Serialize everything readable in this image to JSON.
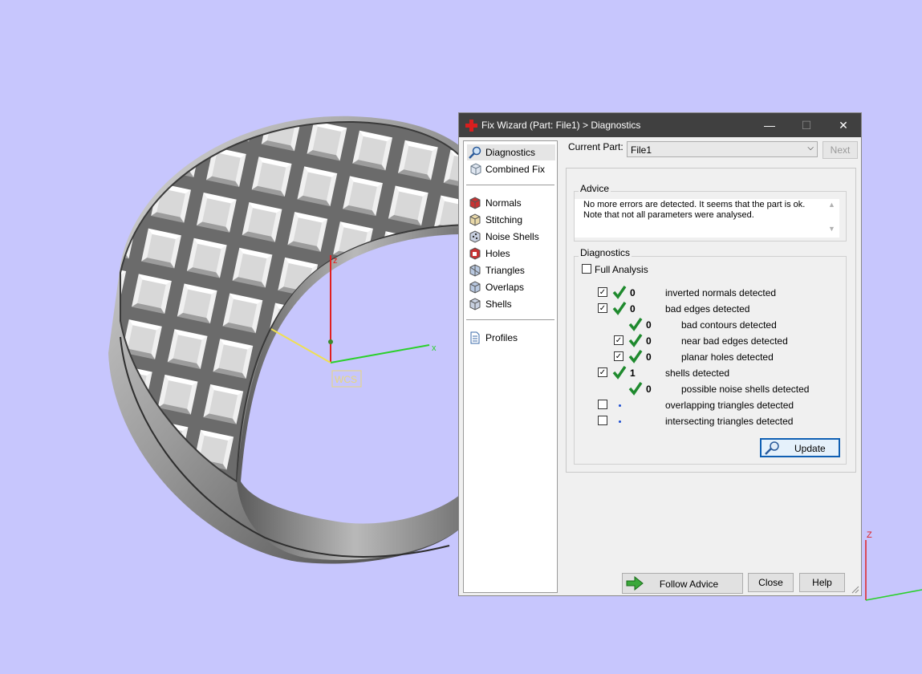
{
  "viewport": {
    "wcs_label": "WCS",
    "axes": {
      "z": "z",
      "x": "x"
    },
    "corner_axis_z": "Z"
  },
  "dialog": {
    "title": "Fix Wizard (Part: File1) > Diagnostics",
    "title_buttons": {
      "minimize": "—",
      "maximize": "☐",
      "close": "✕"
    },
    "nav": {
      "items": [
        {
          "label": "Diagnostics",
          "icon": "magnifier-icon",
          "selected": true
        },
        {
          "label": "Combined Fix",
          "icon": "cube-icon"
        },
        {
          "label": "Normals",
          "icon": "normals-cube-icon"
        },
        {
          "label": "Stitching",
          "icon": "stitching-cube-icon"
        },
        {
          "label": "Noise Shells",
          "icon": "noise-shells-icon"
        },
        {
          "label": "Holes",
          "icon": "holes-cube-icon"
        },
        {
          "label": "Triangles",
          "icon": "triangles-cube-icon"
        },
        {
          "label": "Overlaps",
          "icon": "overlaps-cube-icon"
        },
        {
          "label": "Shells",
          "icon": "shells-cube-icon"
        },
        {
          "label": "Profiles",
          "icon": "document-icon"
        }
      ]
    },
    "current_part": {
      "label": "Current Part:",
      "value": "File1"
    },
    "next_label": "Next",
    "advice": {
      "title": "Advice",
      "line1": "No more errors are detected. It seems that the part is ok.",
      "line2": "Note that not all parameters were analysed."
    },
    "diagnostics": {
      "title": "Diagnostics",
      "full_analysis": {
        "label": "Full Analysis",
        "checked": false
      },
      "rows": [
        {
          "checkbox": true,
          "checked": true,
          "status": "check",
          "count": "0",
          "label": "inverted normals detected",
          "indent": 0
        },
        {
          "checkbox": true,
          "checked": true,
          "status": "check",
          "count": "0",
          "label": "bad edges detected",
          "indent": 0
        },
        {
          "checkbox": false,
          "checked": false,
          "status": "check",
          "count": "0",
          "label": "bad contours detected",
          "indent": 1
        },
        {
          "checkbox": true,
          "checked": true,
          "status": "check",
          "count": "0",
          "label": "near bad edges detected",
          "indent": 1
        },
        {
          "checkbox": true,
          "checked": true,
          "status": "check",
          "count": "0",
          "label": "planar holes detected",
          "indent": 1
        },
        {
          "checkbox": true,
          "checked": true,
          "status": "check",
          "count": "1",
          "label": "shells detected",
          "indent": 0
        },
        {
          "checkbox": false,
          "checked": false,
          "status": "check",
          "count": "0",
          "label": "possible noise shells detected",
          "indent": 1
        },
        {
          "checkbox": true,
          "checked": false,
          "status": "dot",
          "count": "",
          "label": "overlapping triangles detected",
          "indent": 0
        },
        {
          "checkbox": true,
          "checked": false,
          "status": "dot",
          "count": "",
          "label": "intersecting triangles detected",
          "indent": 0
        }
      ],
      "update_label": "Update"
    },
    "footer": {
      "follow_advice": "Follow Advice",
      "close": "Close",
      "help": "Help"
    },
    "colors": {
      "titlebar": "#404040",
      "check_green": "#1f8a2e",
      "accent_blue": "#0f5fb3"
    }
  }
}
